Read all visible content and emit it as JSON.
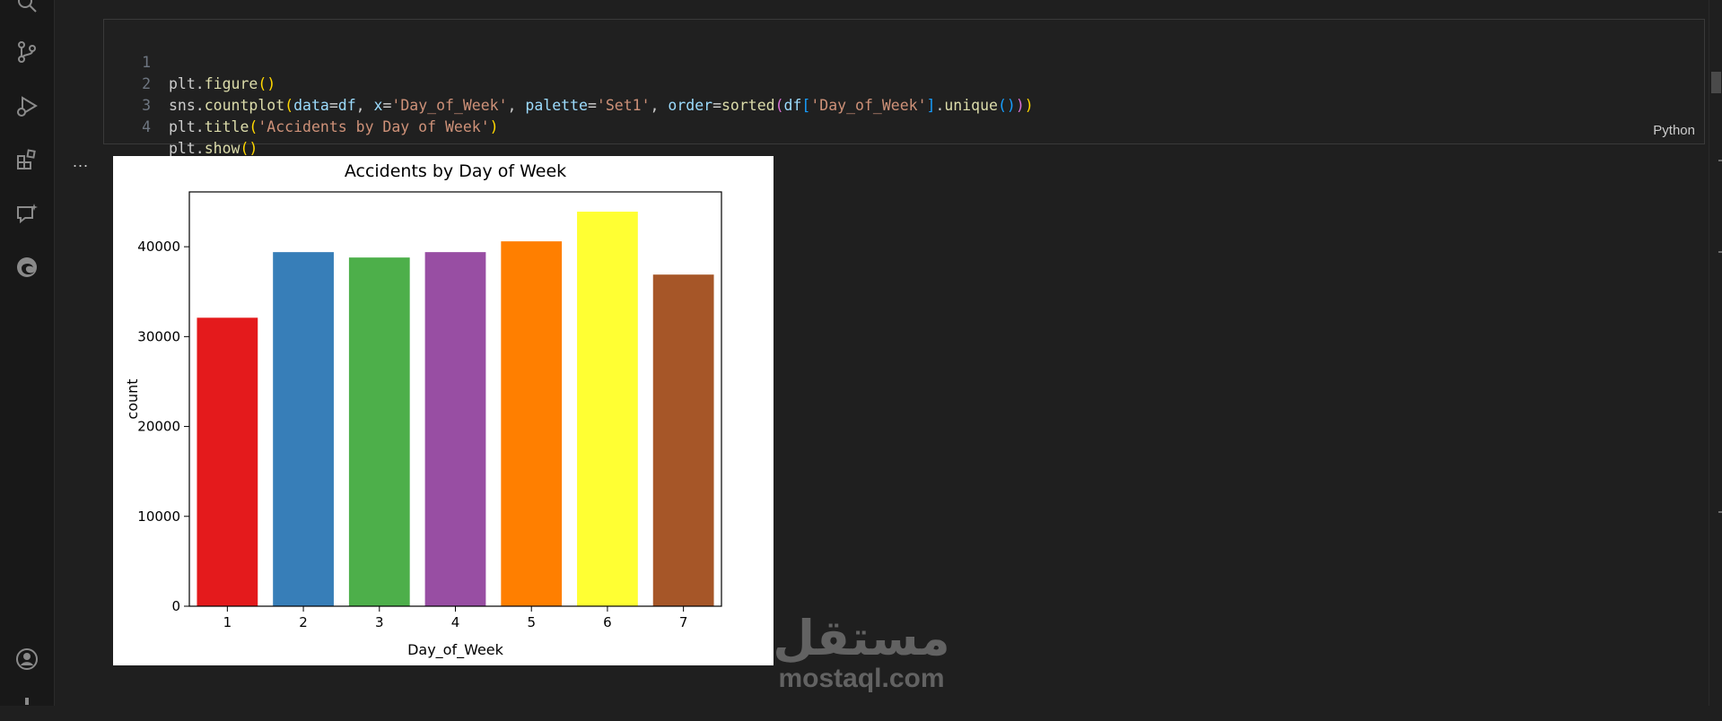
{
  "activity_bar": {
    "icons": [
      "search-icon",
      "source-control-icon",
      "run-debug-icon",
      "extensions-icon",
      "chat-icon",
      "edge-browser-icon",
      "account-icon"
    ]
  },
  "cell": {
    "language": "Python",
    "lines": [
      {
        "num": "1",
        "code": "plt.figure()"
      },
      {
        "num": "2",
        "code": "sns.countplot(data=df, x='Day_of_Week', palette='Set1', order=sorted(df['Day_of_Week'].unique()))"
      },
      {
        "num": "3",
        "code": "plt.title('Accidents by Day of Week')"
      },
      {
        "num": "4",
        "code": "plt.show()"
      }
    ]
  },
  "output": {
    "more_label": "..."
  },
  "chart_data": {
    "type": "bar",
    "title": "Accidents by Day of Week",
    "xlabel": "Day_of_Week",
    "ylabel": "count",
    "categories": [
      "1",
      "2",
      "3",
      "4",
      "5",
      "6",
      "7"
    ],
    "values": [
      32100,
      39400,
      38800,
      39400,
      40600,
      43900,
      36900
    ],
    "colors": [
      "#e41a1c",
      "#377eb8",
      "#4daf4a",
      "#984ea3",
      "#ff7f00",
      "#ffff33",
      "#a65628"
    ],
    "yticks": [
      0,
      10000,
      20000,
      30000,
      40000
    ],
    "ylim": [
      0,
      46100
    ],
    "grid": false,
    "legend": "none"
  },
  "watermark": {
    "logo": "مستقل",
    "text": "mostaql.com"
  }
}
